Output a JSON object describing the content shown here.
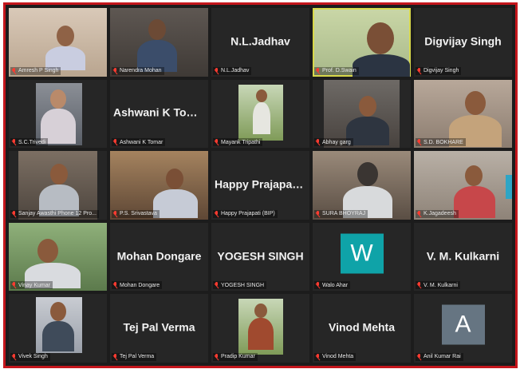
{
  "app": {
    "title": "Video conference gallery view"
  },
  "tiles": [
    {
      "label": "Amresh P Singh"
    },
    {
      "label": "Narendra Mohan"
    },
    {
      "big": "N.L.Jadhav",
      "label": "N.L.Jadhav"
    },
    {
      "label": "Prof. D.Swain"
    },
    {
      "big": "Digvijay Singh",
      "label": "Digvijay Singh"
    },
    {
      "label": "S.C.Trivedi"
    },
    {
      "big": "Ashwani K Tomar",
      "label": "Ashwani K Tomar"
    },
    {
      "label": "Mayank Tripathi"
    },
    {
      "label": "Abhay garg"
    },
    {
      "label": "S.D. BOKHARE"
    },
    {
      "label": "Sanjay Awasthi Phone 12 Pro..."
    },
    {
      "label": "P.S. Srivastava"
    },
    {
      "big": "Happy Prajapati...",
      "label": "Happy Prajapati (BIP)"
    },
    {
      "label": "SURA BHOYRAJ"
    },
    {
      "label": "K.Jagadeesh"
    },
    {
      "label": "Vinay Kumar"
    },
    {
      "big": "Mohan Dongare",
      "label": "Mohan Dongare"
    },
    {
      "big": "YOGESH SINGH",
      "label": "YOGESH SINGH"
    },
    {
      "avatar_letter": "W",
      "label": "Walo Ahar"
    },
    {
      "big": "V. M. Kulkarni",
      "label": "V. M. Kulkarni"
    },
    {
      "label": "Vivek Singh"
    },
    {
      "big": "Tej Pal Verma",
      "label": "Tej Pal Verma"
    },
    {
      "label": "Pradip Kumar"
    },
    {
      "big": "Vinod Mehta",
      "label": "Vinod Mehta"
    },
    {
      "avatar_letter": "A",
      "label": "Anil Kumar Rai"
    }
  ],
  "colors": {
    "frame": "#c4161c",
    "background": "#1c1c1c",
    "tile": "#262626",
    "active_outline": "#d8d84a",
    "mic_muted": "#ff3b30",
    "avatar_w": "#0fa3a8",
    "avatar_a": "#667582"
  },
  "icons": {
    "mic": "muted-mic-icon"
  }
}
